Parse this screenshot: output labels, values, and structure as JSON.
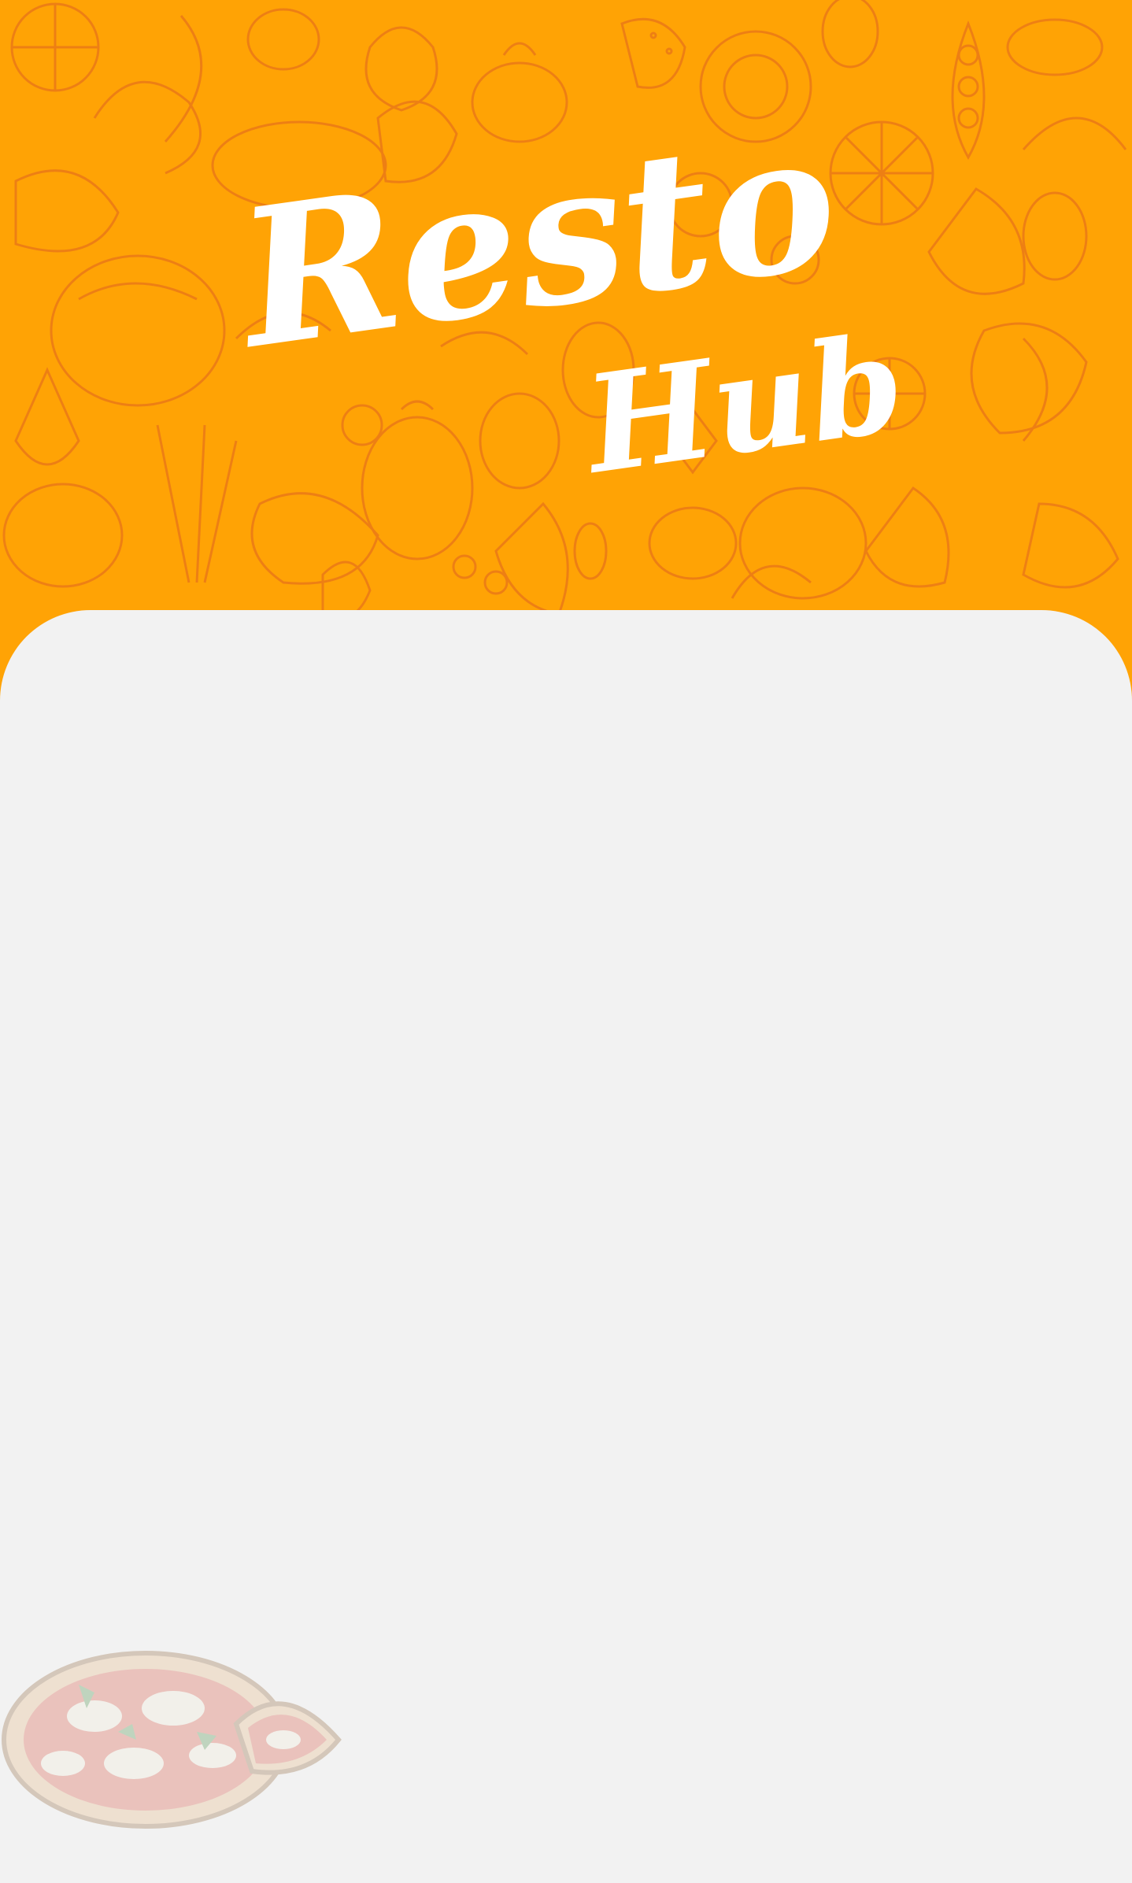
{
  "app": {
    "logo_line1": "Resto",
    "logo_line2": "Hub"
  },
  "colors": {
    "brand_orange": "#ffa305",
    "pattern_line": "#e8741a",
    "card_background": "#f2f2f2",
    "logo_text": "#ffffff"
  },
  "icons": {
    "background_pattern": "fruit-vegetable-pattern-icon",
    "decoration": "pizza-icon"
  }
}
